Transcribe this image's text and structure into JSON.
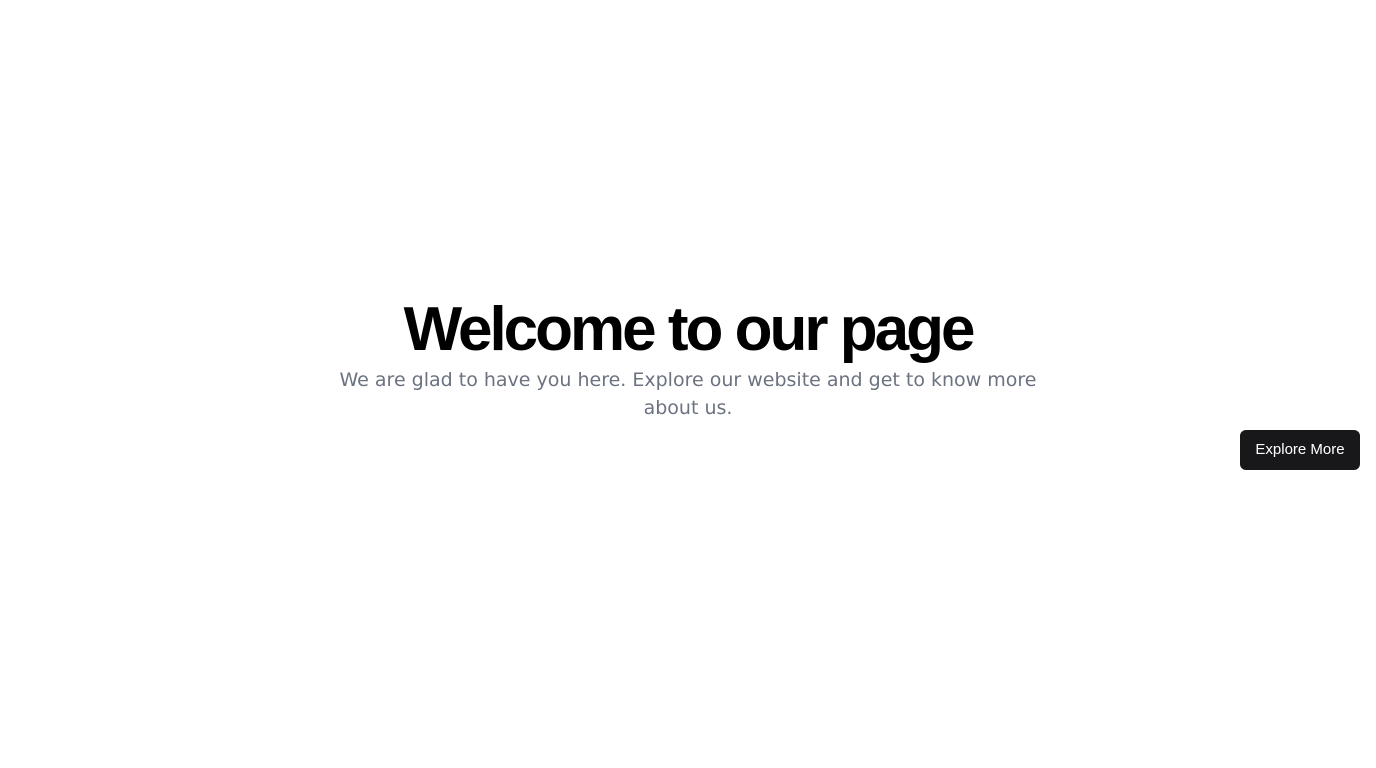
{
  "hero": {
    "title": "Welcome to our page",
    "subtitle": "We are glad to have you here. Explore our website and get to know more about us."
  },
  "cta": {
    "label": "Explore More"
  },
  "colors": {
    "background": "#ffffff",
    "title": "#000000",
    "subtitle": "#6b7280",
    "button_background": "#18181b",
    "button_text": "#ffffff"
  }
}
